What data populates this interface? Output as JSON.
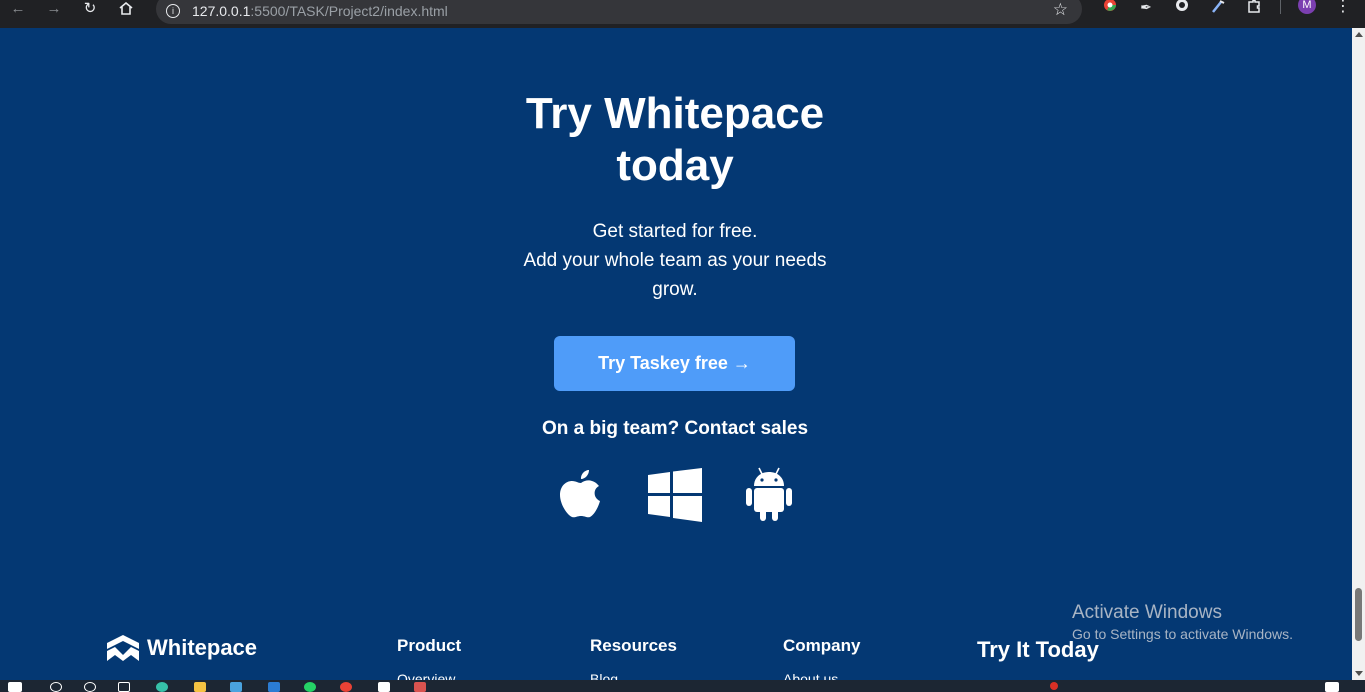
{
  "browser": {
    "url_host": "127.0.0.1",
    "url_path": ":5500/TASK/Project2/index.html",
    "profile_initial": "M"
  },
  "hero": {
    "title_line1": "Try Whitepace",
    "title_line2": "today",
    "subtitle_line1": "Get started for free.",
    "subtitle_line2": "Add your whole team as your needs",
    "subtitle_line3": "grow.",
    "cta_label": "Try Taskey free →",
    "contact_text": "On a big team? Contact sales",
    "platforms": [
      "apple-icon",
      "windows-icon",
      "android-icon"
    ]
  },
  "footer": {
    "brand": "Whitepace",
    "columns": [
      {
        "title": "Product",
        "first_link": "Overview"
      },
      {
        "title": "Resources",
        "first_link": "Blog"
      },
      {
        "title": "Company",
        "first_link": "About us"
      }
    ],
    "try_title": "Try It Today"
  },
  "watermark": {
    "title": "Activate Windows",
    "subtitle": "Go to Settings to activate Windows."
  },
  "colors": {
    "background": "#043873",
    "cta": "#4f9cf9",
    "text": "#ffffff"
  }
}
